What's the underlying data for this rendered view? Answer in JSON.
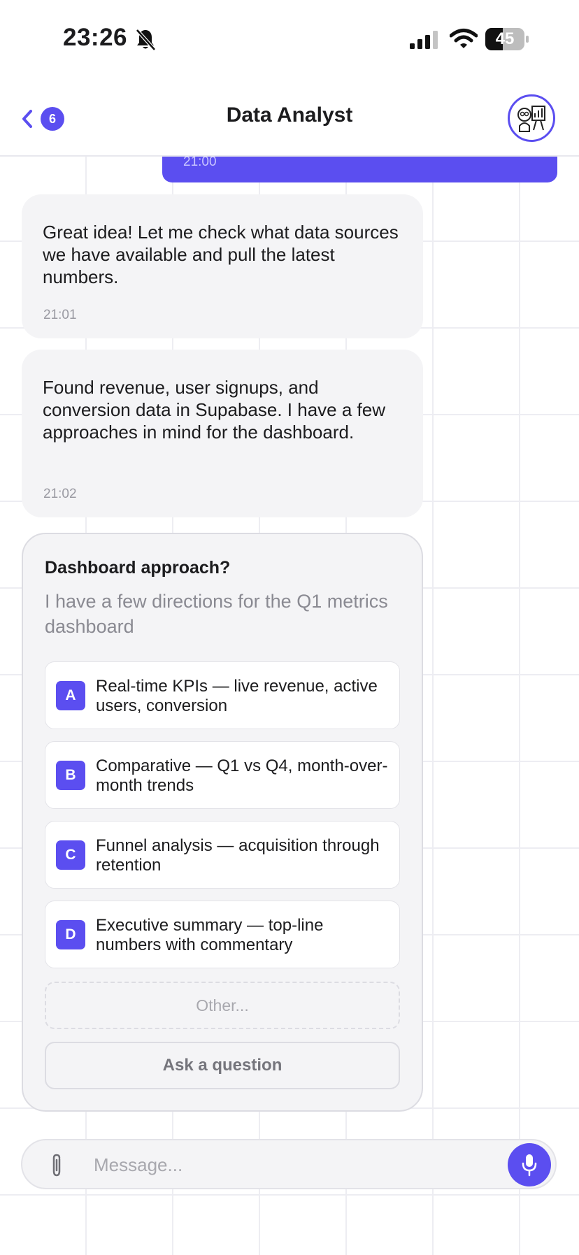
{
  "status_bar": {
    "time": "23:26",
    "battery_percent": "45",
    "battery_level": 0.45,
    "icons": [
      "bell-slash-icon",
      "cellular-signal-icon",
      "wifi-icon",
      "battery-icon"
    ]
  },
  "header": {
    "back_count": "6",
    "title": "Data Analyst",
    "avatar_icon": "analyst-presentation-icon"
  },
  "messages": [
    {
      "sender": "user",
      "time": "21:00"
    },
    {
      "sender": "assistant",
      "text": "Great idea! Let me check what data sources we have available and pull the latest numbers.",
      "time": "21:01"
    },
    {
      "sender": "assistant",
      "text": "Found revenue, user signups, and conversion data in Supabase. I have a few approaches in mind for the dashboard.",
      "time": "21:02"
    }
  ],
  "question_card": {
    "title": "Dashboard approach?",
    "subtitle": "I have a few directions for the Q1 metrics dashboard",
    "options": [
      {
        "letter": "A",
        "text": "Real-time KPIs — live revenue, active users, conversion"
      },
      {
        "letter": "B",
        "text": "Comparative — Q1 vs Q4, month-over-month trends"
      },
      {
        "letter": "C",
        "text": "Funnel analysis — acquisition through retention"
      },
      {
        "letter": "D",
        "text": "Executive summary — top-line numbers with commentary"
      }
    ],
    "other_placeholder": "Other...",
    "ask_label": "Ask a question"
  },
  "composer": {
    "placeholder": "Message...",
    "attach_icon": "paperclip-icon",
    "mic_icon": "microphone-icon"
  },
  "colors": {
    "accent": "#5b4ef0",
    "bubble_bg": "#f4f4f6",
    "text": "#1c1c1e",
    "muted": "#8a8a92"
  }
}
